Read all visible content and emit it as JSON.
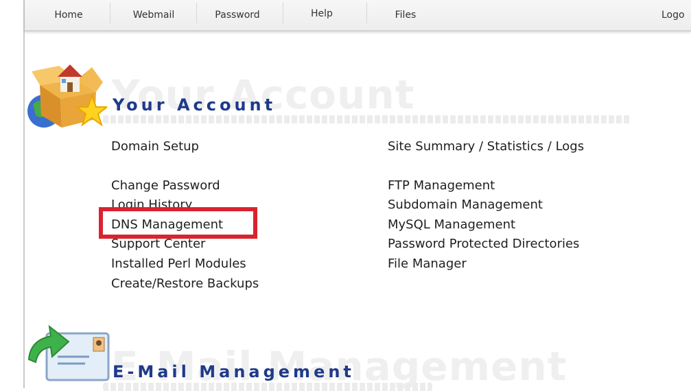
{
  "nav": {
    "items": [
      {
        "id": "home",
        "label": "Home"
      },
      {
        "id": "webmail",
        "label": "Webmail"
      },
      {
        "id": "password",
        "label": "Password"
      },
      {
        "id": "help",
        "label": "Help"
      },
      {
        "id": "files",
        "label": "Files"
      },
      {
        "id": "logout",
        "label": "Logo"
      }
    ]
  },
  "your_account": {
    "title": "Your Account",
    "ghost_title": "Your Account",
    "left_links": [
      {
        "label": "Domain Setup"
      },
      {
        "label": "Change Password"
      },
      {
        "label": "Login History"
      },
      {
        "label": "DNS Management"
      },
      {
        "label": "Support Center"
      },
      {
        "label": "Installed Perl Modules"
      },
      {
        "label": "Create/Restore Backups"
      }
    ],
    "right_links": [
      {
        "label": "Site Summary / Statistics / Logs"
      },
      {
        "label": "FTP Management"
      },
      {
        "label": "Subdomain Management"
      },
      {
        "label": "MySQL Management"
      },
      {
        "label": "Password Protected Directories"
      },
      {
        "label": "File Manager"
      }
    ]
  },
  "email_management": {
    "title": "E-Mail Management",
    "ghost_title": "E-Mail Management"
  },
  "colors": {
    "title_blue": "#1f3a8a",
    "highlight_red": "#d9232e"
  },
  "icons": {
    "account": "package-house-globe-star-icon",
    "email": "envelope-arrow-icon"
  }
}
